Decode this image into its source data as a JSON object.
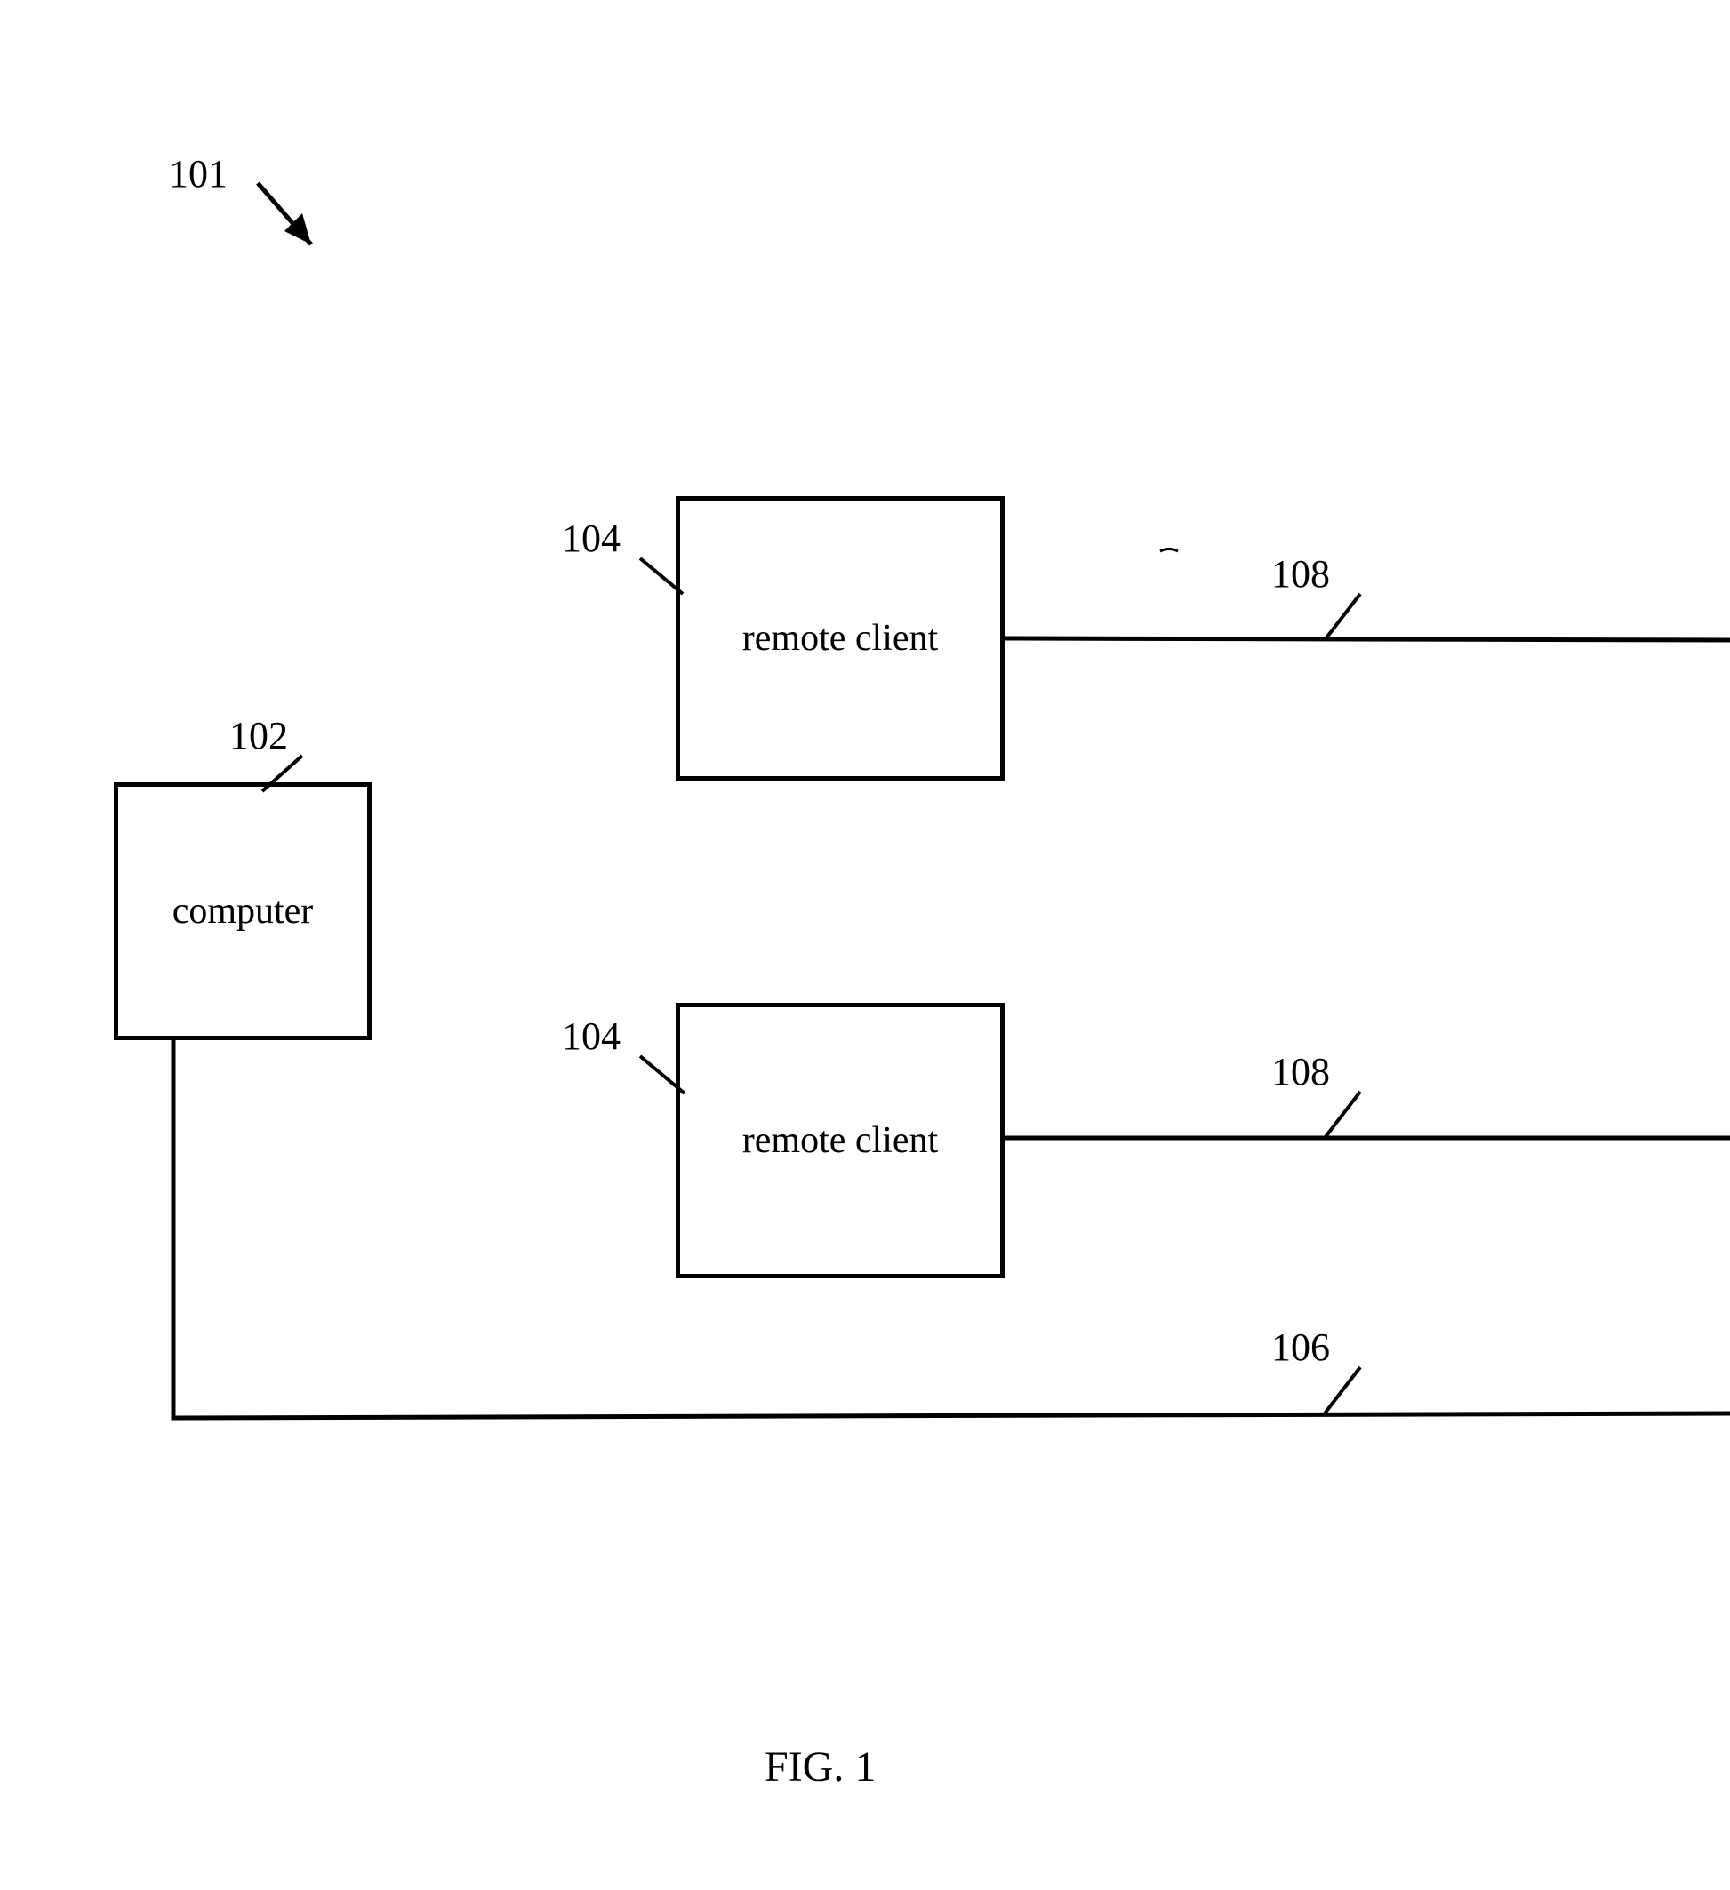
{
  "labels": {
    "ref101": "101",
    "ref102": "102",
    "ref104a": "104",
    "ref104b": "104",
    "ref108a": "108",
    "ref108b": "108",
    "ref106": "106"
  },
  "boxes": {
    "computer": "computer",
    "remoteClientA": "remote client",
    "remoteClientB": "remote client"
  },
  "figure": {
    "caption": "FIG. 1"
  }
}
